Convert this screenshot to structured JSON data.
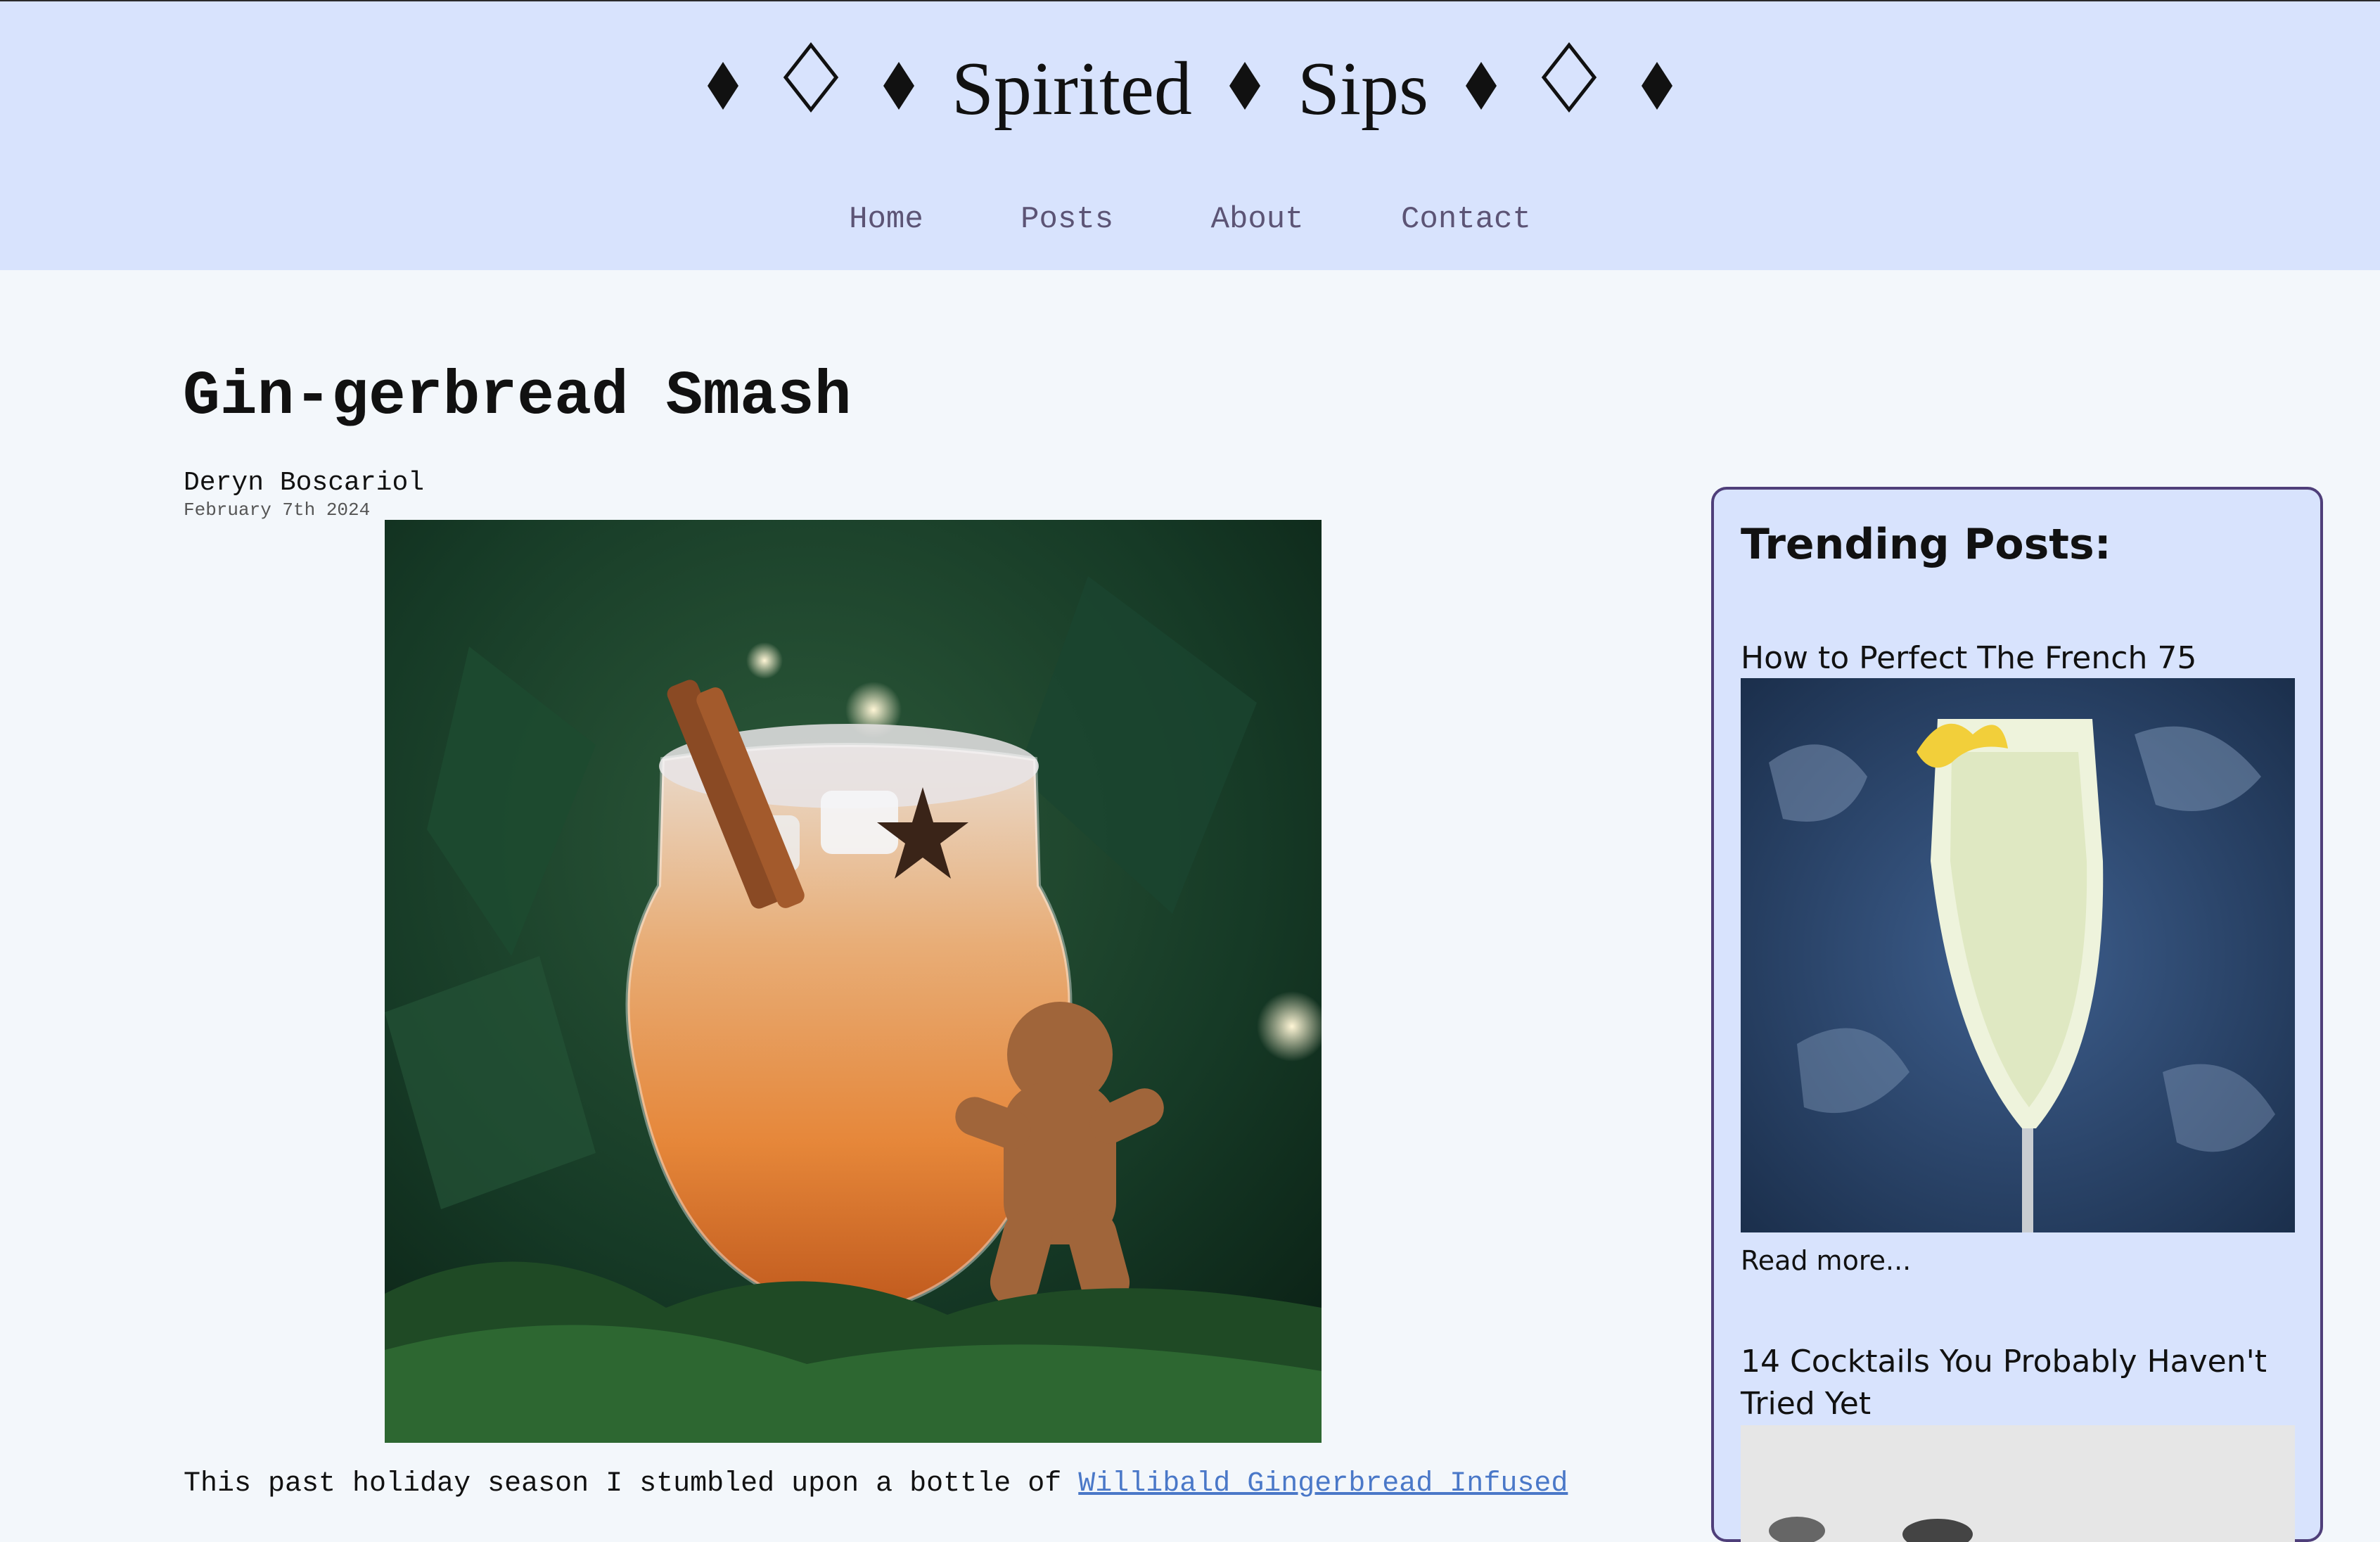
{
  "header": {
    "title_word1": "Spirited",
    "title_word2": "Sips",
    "ornament_filled": "♦",
    "nav": [
      "Home",
      "Posts",
      "About",
      "Contact"
    ]
  },
  "post": {
    "title": "Gin-gerbread Smash",
    "author": "Deryn Boscariol",
    "date": "February 7th 2024",
    "hero_image_icon": "gingerbread-cocktail-photo",
    "body_start": "This past holiday season I stumbled upon a bottle of ",
    "body_link": "Willibald Gingerbread Infused"
  },
  "sidebar": {
    "heading": "Trending Posts:",
    "items": [
      {
        "title": "How to Perfect The French 75",
        "read_more": "Read more...",
        "image_icon": "french-75-photo"
      },
      {
        "title": "14 Cocktails You Probably Haven't Tried Yet",
        "image_icon": "cocktails-photo"
      }
    ]
  },
  "colors": {
    "header_bg": "#d8e3fd",
    "page_bg": "#f3f7fb",
    "nav_text": "#5c5475",
    "link": "#4a78c8",
    "sidebar_border": "#4f3f7a"
  }
}
